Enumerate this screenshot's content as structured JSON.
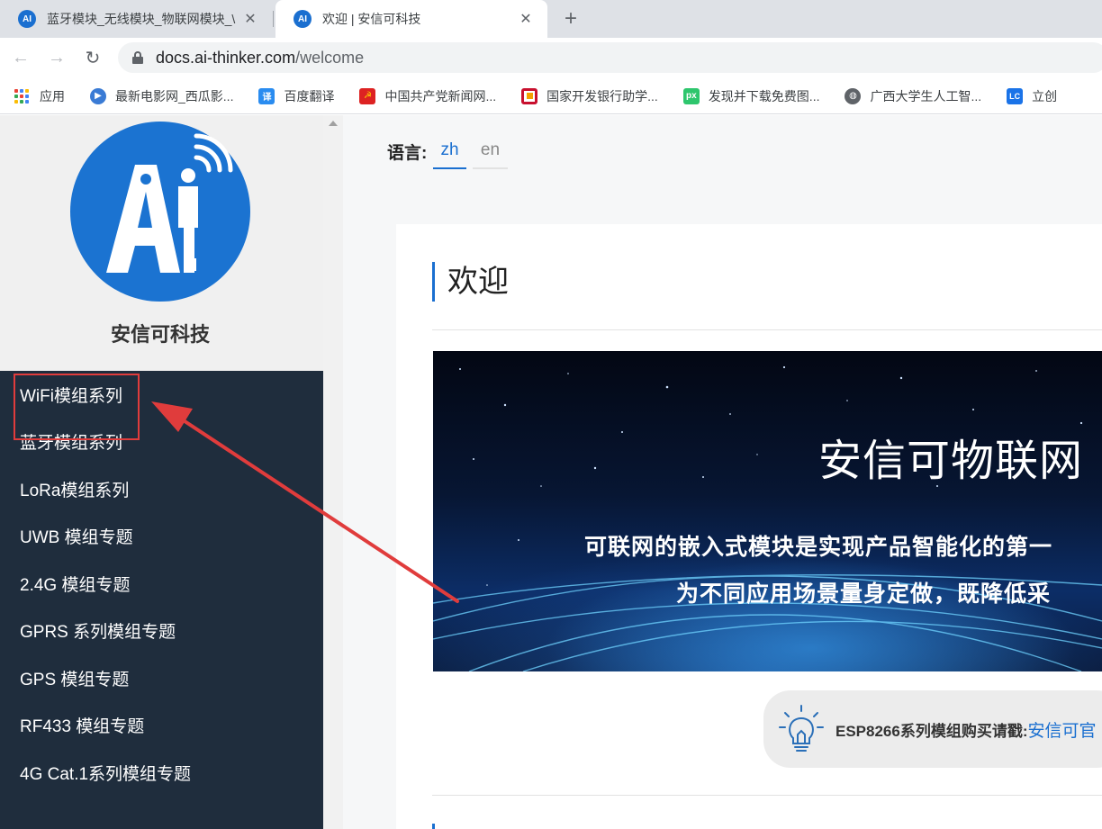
{
  "browser": {
    "tabs": [
      {
        "title": "蓝牙模块_无线模块_物联网模块_\\",
        "favicon": "AI"
      },
      {
        "title": "欢迎 | 安信可科技",
        "favicon": "AI"
      }
    ],
    "url_host": "docs.ai-thinker.com",
    "url_path": "/welcome",
    "bookmarks": [
      {
        "label": "应用",
        "icon": "apps-grid-icon"
      },
      {
        "label": "最新电影网_西瓜影...",
        "icon": "movie-icon",
        "color": "#3a7bd5"
      },
      {
        "label": "百度翻译",
        "icon": "translate-icon",
        "color": "#2a8cf0",
        "glyph": "译"
      },
      {
        "label": "中国共产党新闻网...",
        "icon": "party-icon",
        "color": "#d22",
        "glyph": "☭"
      },
      {
        "label": "国家开发银行助学...",
        "icon": "bank-icon",
        "color": "#c8102e"
      },
      {
        "label": "发现并下载免费图...",
        "icon": "pixabay-icon",
        "color": "#2ec66d",
        "glyph": "px"
      },
      {
        "label": "广西大学生人工智...",
        "icon": "globe-icon",
        "color": "#5f6368"
      },
      {
        "label": "立创",
        "icon": "lc-icon",
        "color": "#1a73e8",
        "glyph": "LC"
      }
    ]
  },
  "sidebar": {
    "site_name": "安信可科技",
    "logo_text": "A.I",
    "items": [
      {
        "label": "WiFi模组系列"
      },
      {
        "label": "蓝牙模组系列"
      },
      {
        "label": "LoRa模组系列"
      },
      {
        "label": "UWB 模组专题"
      },
      {
        "label": "2.4G 模组专题"
      },
      {
        "label": "GPRS 系列模组专题"
      },
      {
        "label": "GPS 模组专题"
      },
      {
        "label": "RF433 模组专题"
      },
      {
        "label": "4G Cat.1系列模组专题"
      }
    ]
  },
  "content": {
    "lang_label": "语言:",
    "lang_options": [
      "zh",
      "en"
    ],
    "page_title": "欢迎",
    "banner_title": "安信可物联网",
    "banner_line1": "可联网的嵌入式模块是实现产品智能化的第一",
    "banner_line2": "为不同应用场景量身定做，既降低采",
    "tip_text": "ESP8266系列模组购买请戳:",
    "tip_link": "安信可官"
  },
  "colors": {
    "accent": "#1a6fd0",
    "sidebar_bg": "#1f2d3d",
    "annotation_red": "#e03c3c"
  }
}
